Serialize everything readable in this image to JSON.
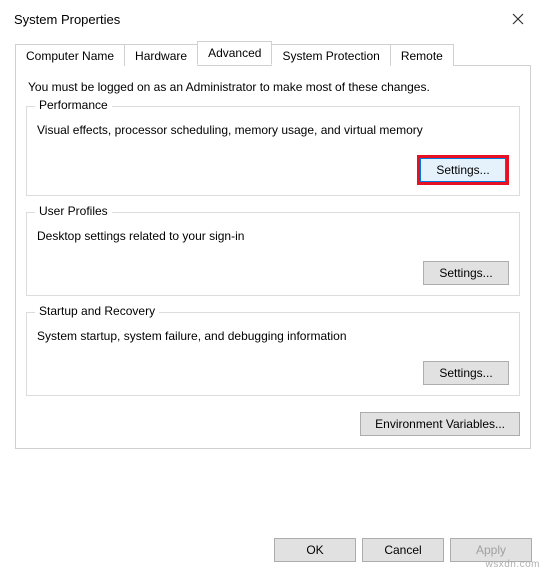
{
  "window": {
    "title": "System Properties"
  },
  "tabs": {
    "computer_name": "Computer Name",
    "hardware": "Hardware",
    "advanced": "Advanced",
    "system_protection": "System Protection",
    "remote": "Remote"
  },
  "advanced_panel": {
    "intro": "You must be logged on as an Administrator to make most of these changes.",
    "performance": {
      "legend": "Performance",
      "desc": "Visual effects, processor scheduling, memory usage, and virtual memory",
      "button": "Settings..."
    },
    "user_profiles": {
      "legend": "User Profiles",
      "desc": "Desktop settings related to your sign-in",
      "button": "Settings..."
    },
    "startup_recovery": {
      "legend": "Startup and Recovery",
      "desc": "System startup, system failure, and debugging information",
      "button": "Settings..."
    },
    "env_button": "Environment Variables..."
  },
  "dialog_buttons": {
    "ok": "OK",
    "cancel": "Cancel",
    "apply": "Apply"
  },
  "watermark": "wsxdn.com"
}
